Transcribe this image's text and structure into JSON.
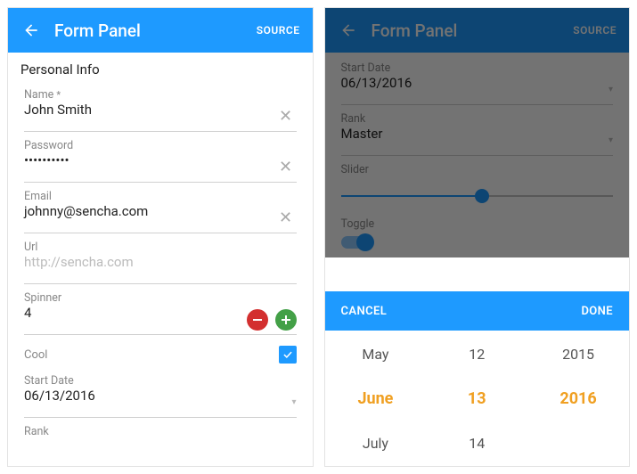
{
  "left": {
    "header": {
      "title": "Form Panel",
      "source": "SOURCE"
    },
    "section_title": "Personal Info",
    "fields": {
      "name": {
        "label": "Name",
        "required_mark": "*",
        "value": "John Smith"
      },
      "password": {
        "label": "Password",
        "value": "••••••••••"
      },
      "email": {
        "label": "Email",
        "value": "johnny@sencha.com"
      },
      "url": {
        "label": "Url",
        "placeholder": "http://sencha.com"
      },
      "spinner": {
        "label": "Spinner",
        "value": "4"
      },
      "cool": {
        "label": "Cool",
        "checked": true
      },
      "start_date": {
        "label": "Start Date",
        "value": "06/13/2016"
      },
      "rank": {
        "label": "Rank"
      }
    }
  },
  "right": {
    "header": {
      "title": "Form Panel",
      "source": "SOURCE"
    },
    "fields": {
      "start_date": {
        "label": "Start Date",
        "value": "06/13/2016"
      },
      "rank": {
        "label": "Rank",
        "value": "Master"
      },
      "slider": {
        "label": "Slider",
        "percent": 52
      },
      "toggle": {
        "label": "Toggle",
        "on": true
      }
    },
    "picker": {
      "cancel": "CANCEL",
      "done": "DONE",
      "months": {
        "prev": "May",
        "sel": "June",
        "next": "July"
      },
      "days": {
        "prev": "12",
        "sel": "13",
        "next": "14"
      },
      "years": {
        "prev": "2015",
        "sel": "2016",
        "next": ""
      }
    }
  }
}
